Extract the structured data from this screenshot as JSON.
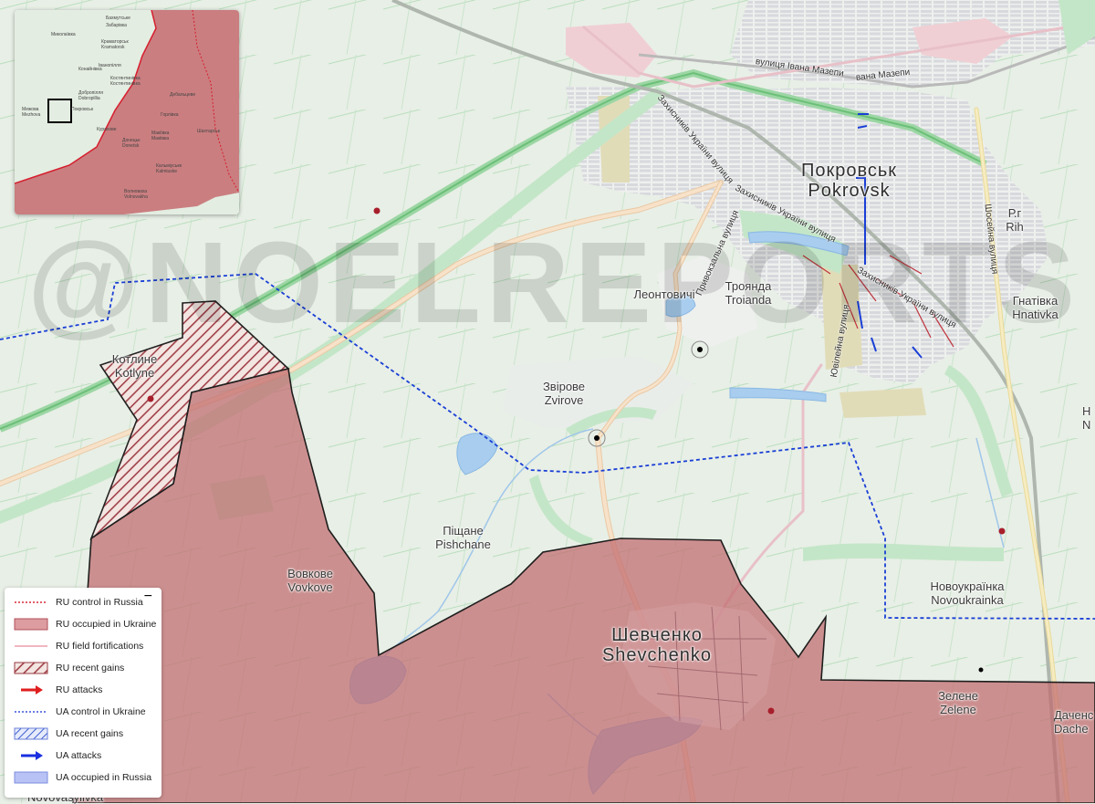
{
  "watermark": "@NOELREPORTS",
  "places": {
    "pokrovsk": {
      "uk": "Покровськ",
      "en": "Pokrovsk"
    },
    "rih": {
      "uk": "Р.г",
      "en": "Rih"
    },
    "leontovichi": {
      "uk": "Леонтовичі"
    },
    "troianda": {
      "uk": "Троянда",
      "en": "Troianda"
    },
    "hnativka": {
      "uk": "Гнатівка",
      "en": "Hnativka"
    },
    "kotlyne": {
      "uk": "Котлине",
      "en": "Kotlyne"
    },
    "zvirove": {
      "uk": "Звірове",
      "en": "Zvirove"
    },
    "pishchane": {
      "uk": "Піщане",
      "en": "Pishchane"
    },
    "vovkove": {
      "uk": "Вовкове",
      "en": "Vovkove"
    },
    "novoukrainka": {
      "uk": "Новоукраїнка",
      "en": "Novoukrainka"
    },
    "shevchenko": {
      "uk": "Шевченко",
      "en": "Shevchenko"
    },
    "zelene": {
      "uk": "Зелене",
      "en": "Zelene"
    },
    "dachenske": {
      "uk": "Даченс",
      "en": "Dache"
    },
    "novovasylivka": {
      "uk": "Novovasylivka"
    },
    "edge_n": {
      "uk": "Н",
      "en": "N"
    }
  },
  "streets": {
    "mazepy1": "вулиця Івана Мазепи",
    "mazepy2": "вана Мазепи",
    "zakhysnykiv1": "Захисників України вулиця",
    "zakhysnykiv2": "Захисників України вулиця",
    "zakhysnykiv3": "Захисників України вулиця",
    "pryvokzalna": "Привокзальна вулиця",
    "yuvileina": "Ювілейна вулиця",
    "shosseina": "Шосейна вулиця"
  },
  "inset": {
    "labels": [
      "Бахмутське",
      "Забарівка",
      "Миколаївка",
      "Краматорськ",
      "Kramatorsk",
      "Іванопілля",
      "Костянтинівка",
      "Костянтинівка",
      "Конайнівка",
      "Добропілля",
      "Dobropillia",
      "Межова",
      "Mezhova",
      "Покровськ",
      "Донецьк",
      "Donetsk",
      "Макіївка",
      "Maкiiвка",
      "Кальміуське",
      "Kalmiuske",
      "Волноваха",
      "Volnovakha",
      "Дебальцеве",
      "Горлівка",
      "Шахтарськ",
      "Курахове"
    ]
  },
  "legend": {
    "collapse_label": "−",
    "items": [
      {
        "label": "RU control in Russia",
        "symbol": "red-dotted-line"
      },
      {
        "label": "RU occupied in Ukraine",
        "symbol": "red-fill"
      },
      {
        "label": "RU field fortifications",
        "symbol": "pink-line"
      },
      {
        "label": "RU recent gains",
        "symbol": "red-hatch"
      },
      {
        "label": "RU attacks",
        "symbol": "red-arrow"
      },
      {
        "label": "UA control in Ukraine",
        "symbol": "blue-dotted-line"
      },
      {
        "label": "UA recent gains",
        "symbol": "blue-hatch"
      },
      {
        "label": "UA attacks",
        "symbol": "blue-arrow"
      },
      {
        "label": "UA occupied in Russia",
        "symbol": "blue-fill"
      }
    ]
  },
  "colors": {
    "ru_fill": "#c06a6e",
    "ru_line": "#d8283a",
    "ua_line": "#1a3fd6",
    "ua_fill": "#8a9cf0",
    "hatch": "#9a3a40",
    "terrain": "#e8efe6",
    "river": "#9ec8ee",
    "road": "#f2d9c2",
    "rail_green": "#8fd49a"
  }
}
